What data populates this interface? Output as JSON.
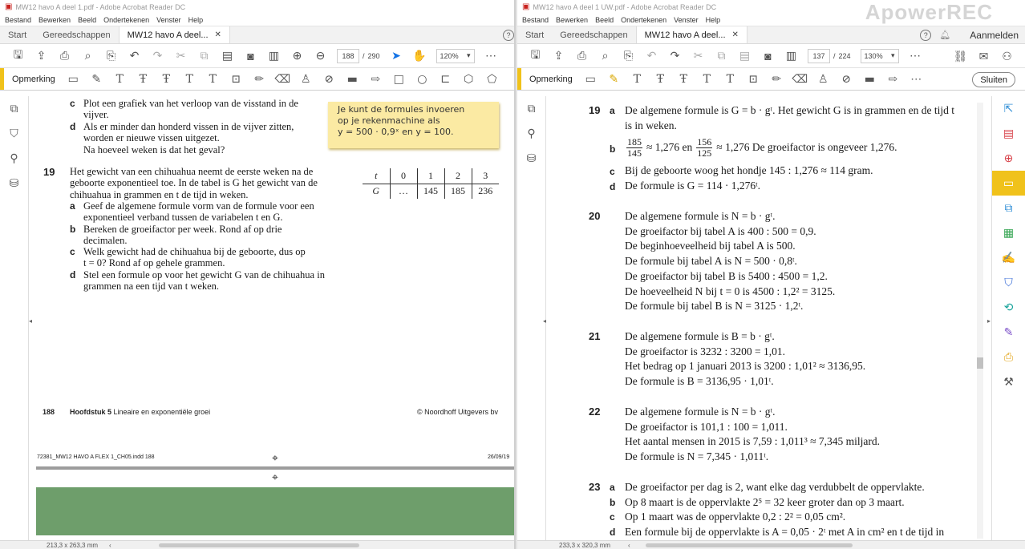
{
  "watermark": "ApowerREC",
  "left": {
    "window_title": "MW12 havo A deel 1.pdf - Adobe Acrobat Reader DC",
    "menu": [
      "Bestand",
      "Bewerken",
      "Beeld",
      "Ondertekenen",
      "Venster",
      "Help"
    ],
    "tabs": {
      "home": "Start",
      "tools": "Gereedschappen",
      "doc": "MW12 havo A deel..."
    },
    "toolbar": {
      "page_current": "188",
      "page_sep": "/",
      "page_total": "290",
      "zoom": "120%"
    },
    "comment_label": "Opmerking",
    "hint": [
      "Je kunt de formules invoeren",
      "op je rekenmachine als",
      "y = 500 · 0,9ˣ en y = 100."
    ],
    "prev_question": {
      "c_text": [
        "Plot een grafiek van het verloop van de visstand in de",
        "vijver."
      ],
      "d_text": [
        "Als er minder dan honderd vissen in de vijver zitten,",
        "worden er nieuwe vissen uitgezet.",
        "Na hoeveel weken is dat het geval?"
      ]
    },
    "q19": {
      "number": "19",
      "intro": [
        "Het gewicht van een chihuahua neemt de eerste weken na de",
        "geboorte exponentieel toe. In de tabel is G het gewicht van de",
        "chihuahua in grammen en t de tijd in weken."
      ],
      "a": [
        "Geef de algemene formule vorm van de formule voor een",
        "exponentieel verband tussen de variabelen t en G."
      ],
      "b": [
        "Bereken de groeifactor per week. Rond af op drie",
        "decimalen."
      ],
      "c": [
        "Welk gewicht had de chihuahua bij de geboorte, dus op",
        "t = 0? Rond af op gehele grammen."
      ],
      "d": [
        "Stel een formule op voor het gewicht G van de chihuahua in",
        "grammen na een tijd van t weken."
      ]
    },
    "table": {
      "header": [
        "t",
        "0",
        "1",
        "2",
        "3"
      ],
      "row": [
        "G",
        "…",
        "145",
        "185",
        "236"
      ]
    },
    "footer": {
      "page_no": "188",
      "chapter_bold": "Hoofdstuk 5",
      "chapter_rest": "Lineaire en exponentiële groei",
      "publisher": "© Noordhoff Uitgevers bv",
      "slug": "72381_MW12 HAVO A FLEX 1_CH05.indd   188",
      "date": "26/09/19"
    },
    "status_size": "213,3 x 263,3 mm"
  },
  "right": {
    "window_title": "MW12 havo A deel 1 UW.pdf - Adobe Acrobat Reader DC",
    "menu": [
      "Bestand",
      "Bewerken",
      "Beeld",
      "Ondertekenen",
      "Venster",
      "Help"
    ],
    "tabs": {
      "home": "Start",
      "tools": "Gereedschappen",
      "doc": "MW12 havo A deel..."
    },
    "sign_in": "Aanmelden",
    "toolbar": {
      "page_current": "137",
      "page_sep": "/",
      "page_total": "224",
      "zoom": "130%"
    },
    "comment_label": "Opmerking",
    "close_label": "Sluiten",
    "a19": {
      "number": "19",
      "a": [
        "De algemene formule is G = b · gᵗ. Het gewicht G is in grammen en de tijd t",
        "is in weken."
      ],
      "b_f1_num": "185",
      "b_f1_den": "145",
      "b_mid": "≈ 1,276 en",
      "b_f2_num": "156",
      "b_f2_den": "125",
      "b_end": "≈ 1,276 De groeifactor is ongeveer 1,276.",
      "c": "Bij de geboorte woog het hondje 145 : 1,276 ≈ 114 gram.",
      "d": "De formule is G = 114 · 1,276ᵗ."
    },
    "a20": {
      "number": "20",
      "lines": [
        "De algemene formule is N = b · gᵗ.",
        "De groeifactor bij tabel A is 400 : 500 = 0,9.",
        "De beginhoeveelheid bij tabel A is 500.",
        "De formule bij tabel A is N = 500 · 0,8ᵗ.",
        "De groeifactor bij tabel B is 5400 : 4500 = 1,2.",
        "De hoeveelheid N bij t = 0 is 4500 : 1,2² = 3125.",
        "De formule bij tabel B is N = 3125 · 1,2ᵗ."
      ]
    },
    "a21": {
      "number": "21",
      "lines": [
        "De algemene formule is B = b · gᵗ.",
        "De groeifactor is 3232 : 3200 = 1,01.",
        "Het bedrag op 1 januari 2013 is 3200 : 1,01² ≈ 3136,95.",
        "De formule is B = 3136,95 · 1,01ᵗ."
      ]
    },
    "a22": {
      "number": "22",
      "lines": [
        "De algemene formule is N = b · gᵗ.",
        "De groeifactor is 101,1 : 100 = 1,011.",
        "Het aantal mensen in 2015 is 7,59 : 1,011³ ≈ 7,345 miljard.",
        "De formule is N = 7,345 · 1,011ᵗ."
      ]
    },
    "a23": {
      "number": "23",
      "a": "De groeifactor per dag is 2, want elke dag verdubbelt de oppervlakte.",
      "b": "Op 8 maart is de oppervlakte 2⁵ = 32 keer groter dan op 3 maart.",
      "c": "Op 1 maart was de oppervlakte 0,2 : 2² = 0,05 cm².",
      "d": "Een formule bij de oppervlakte is A = 0,05 · 2ᵗ met A in cm² en t de tijd in"
    },
    "status_size": "233,3 x 320,3 mm"
  }
}
